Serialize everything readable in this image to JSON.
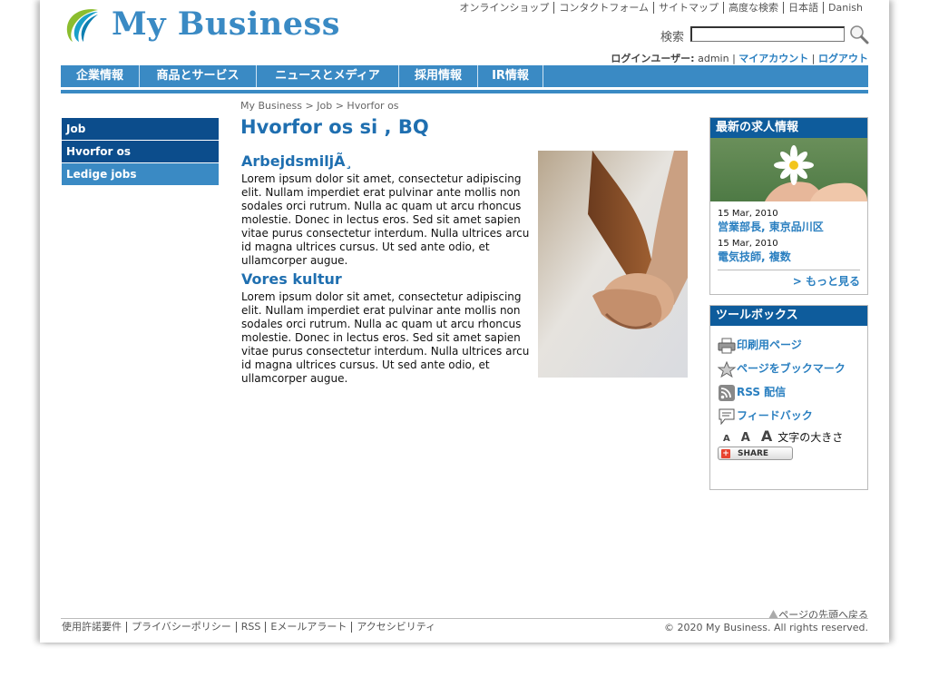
{
  "header": {
    "logo_text": "My Business",
    "top_links": [
      "オンラインショップ",
      "コンタクトフォーム",
      "サイトマップ",
      "高度な検索",
      "日本語",
      "Danish"
    ],
    "search_label": "検索",
    "search_value": "",
    "login": {
      "label": "ログインユーザー:",
      "user": "admin",
      "sep": "|",
      "my_account": "マイアカウント",
      "logout": "ログアウト"
    }
  },
  "nav": {
    "items": [
      "企業情報",
      "商品とサービス",
      "ニュースとメディア",
      "採用情報",
      "IR情報"
    ]
  },
  "sidebar": {
    "items": [
      "Job",
      "Hvorfor os",
      "Ledige jobs"
    ]
  },
  "main": {
    "breadcrumb": [
      "My Business",
      "Job",
      "Hvorfor os"
    ],
    "breadcrumb_sep": ">",
    "title": "Hvorfor os si , BQ",
    "sections": [
      {
        "heading": "ArbejdsmiljÃ¸",
        "text": "Lorem ipsum dolor sit amet, consectetur adipiscing elit. Nullam imperdiet erat pulvinar ante mollis non sodales orci rutrum. Nulla ac quam ut arcu rhoncus molestie. Donec in lectus eros. Sed sit amet sapien vitae purus consectetur interdum. Nulla ultrices arcu id magna ultrices cursus. Ut sed ante odio, et ullamcorper augue."
      },
      {
        "heading": "Vores kultur",
        "text": "Lorem ipsum dolor sit amet, consectetur adipiscing elit. Nullam imperdiet erat pulvinar ante mollis non sodales orci rutrum. Nulla ac quam ut arcu rhoncus molestie. Donec in lectus eros. Sed sit amet sapien vitae purus consectetur interdum. Nulla ultrices arcu id magna ultrices cursus. Ut sed ante odio, et ullamcorper augue."
      }
    ]
  },
  "jobs_box": {
    "title": "最新の求人情報",
    "jobs": [
      {
        "date": "15 Mar, 2010",
        "title": "営業部長, 東京品川区"
      },
      {
        "date": "15 Mar, 2010",
        "title": "電気技師, 複数"
      }
    ],
    "more": "> もっと見る"
  },
  "toolbox": {
    "title": "ツールボックス",
    "print": "印刷用ページ",
    "bookmark": "ページをブックマーク",
    "rss": "RSS 配信",
    "feedback": "フィードバック",
    "font_small": "A",
    "font_medium": "A",
    "font_large": "A",
    "font_label": "文字の大きさ",
    "share": "SHARE"
  },
  "footer": {
    "back_to_top": "ページの先頭へ戻る",
    "links": [
      "使用許諾要件",
      "プライバシーポリシー",
      "RSS",
      "Eメールアラート",
      "アクセシビリティ"
    ],
    "copyright": "© 2020 My Business. All rights reserved."
  },
  "colors": {
    "brand_blue": "#3a8ac4",
    "dark_blue": "#0c4d8c",
    "link_blue": "#2a7fc0",
    "heading_blue": "#1f6fb0"
  }
}
